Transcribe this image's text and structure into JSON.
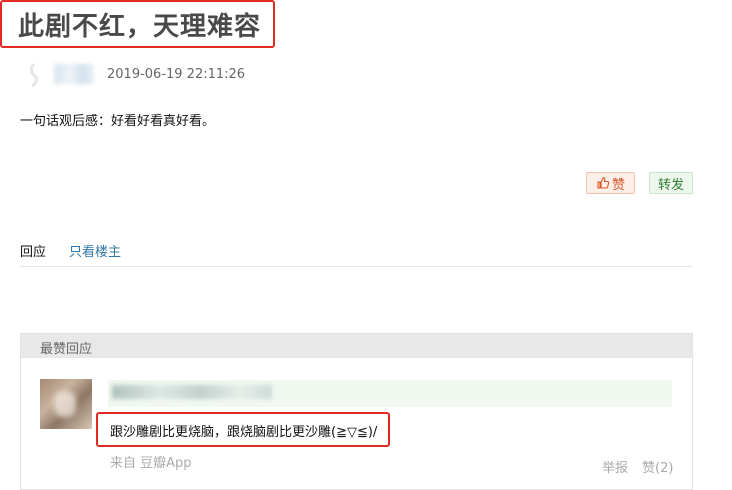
{
  "post": {
    "title": "此剧不红，天理难容",
    "time": "2019-06-19 22:11:26",
    "summary": "一句话观后感：好看好看真好看。"
  },
  "actions": {
    "like_label": "赞",
    "share_label": "转发"
  },
  "tabs": [
    {
      "label": "回应"
    },
    {
      "label": "只看楼主"
    }
  ],
  "best_replies": {
    "title": "最赞回应",
    "reply": {
      "text": "跟沙雕剧比更烧脑，跟烧脑剧比更沙雕(≧▽≦)/",
      "source": "来自 豆瓣App",
      "report_label": "举报",
      "like_label": "赞(2)"
    }
  },
  "colors": {
    "highlight_border": "#e02b23",
    "link": "#3377aa",
    "like_accent": "#d6572b",
    "share_accent": "#2f7d2f"
  }
}
